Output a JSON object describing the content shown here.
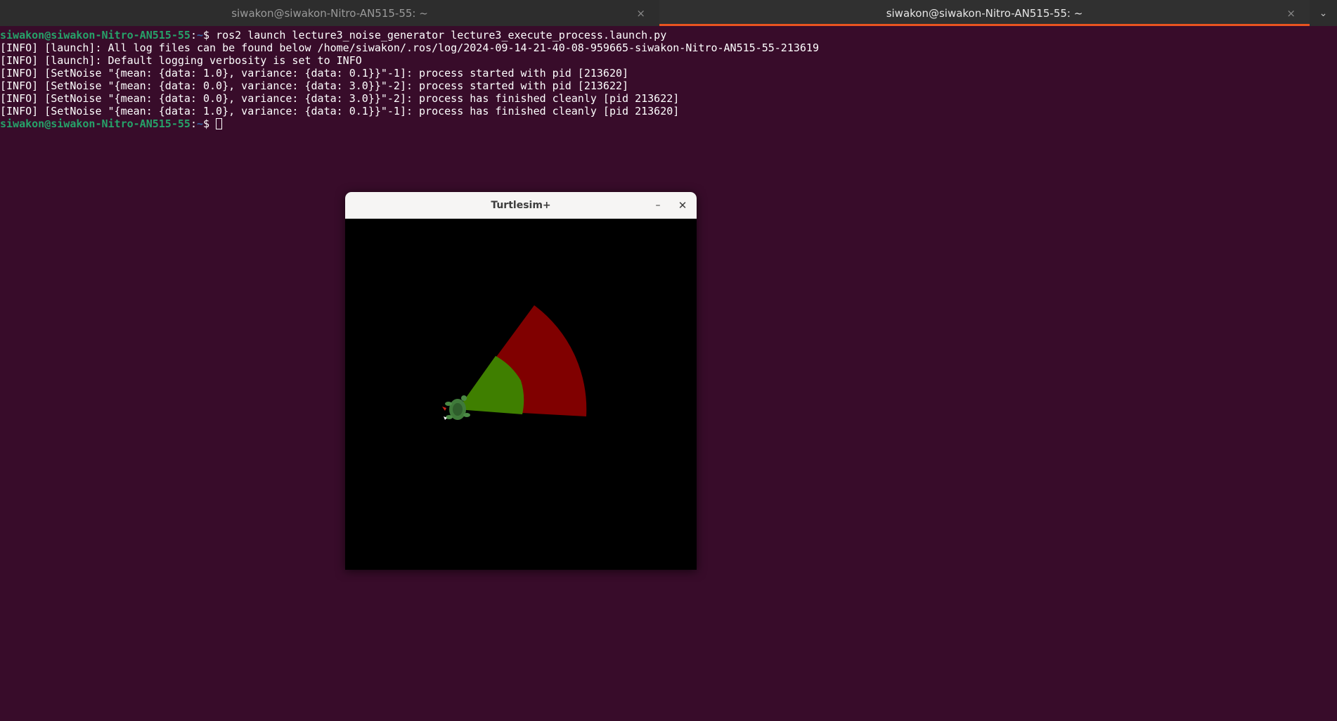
{
  "tabs": [
    {
      "title": "siwakon@siwakon-Nitro-AN515-55: ~",
      "active": false
    },
    {
      "title": "siwakon@siwakon-Nitro-AN515-55: ~",
      "active": true
    }
  ],
  "tab_close_glyph": "×",
  "tab_menu_glyph": "⌄",
  "terminal": {
    "prompt_user": "siwakon@siwakon-Nitro-AN515-55",
    "prompt_sep": ":",
    "prompt_path": "~",
    "prompt_symbol": "$ ",
    "command": "ros2 launch lecture3_noise_generator lecture3_execute_process.launch.py",
    "output": [
      "[INFO] [launch]: All log files can be found below /home/siwakon/.ros/log/2024-09-14-21-40-08-959665-siwakon-Nitro-AN515-55-213619",
      "[INFO] [launch]: Default logging verbosity is set to INFO",
      "[INFO] [SetNoise \"{mean: {data: 1.0}, variance: {data: 0.1}}\"-1]: process started with pid [213620]",
      "[INFO] [SetNoise \"{mean: {data: 0.0}, variance: {data: 3.0}}\"-2]: process started with pid [213622]",
      "[INFO] [SetNoise \"{mean: {data: 0.0}, variance: {data: 3.0}}\"-2]: process has finished cleanly [pid 213622]",
      "[INFO] [SetNoise \"{mean: {data: 1.0}, variance: {data: 0.1}}\"-1]: process has finished cleanly [pid 213620]"
    ]
  },
  "turtlesim": {
    "title": "Turtlesim+",
    "minimize_glyph": "–",
    "close_glyph": "✕",
    "colors": {
      "background": "#000000",
      "outer_sector": "#800000",
      "inner_sector": "#3f7f00",
      "turtle_shell": "#3f7a3a"
    }
  },
  "colors": {
    "terminal_bg": "#380c2a",
    "prompt_user": "#26a269",
    "prompt_path": "#3465a4",
    "tab_accent": "#e95420"
  }
}
